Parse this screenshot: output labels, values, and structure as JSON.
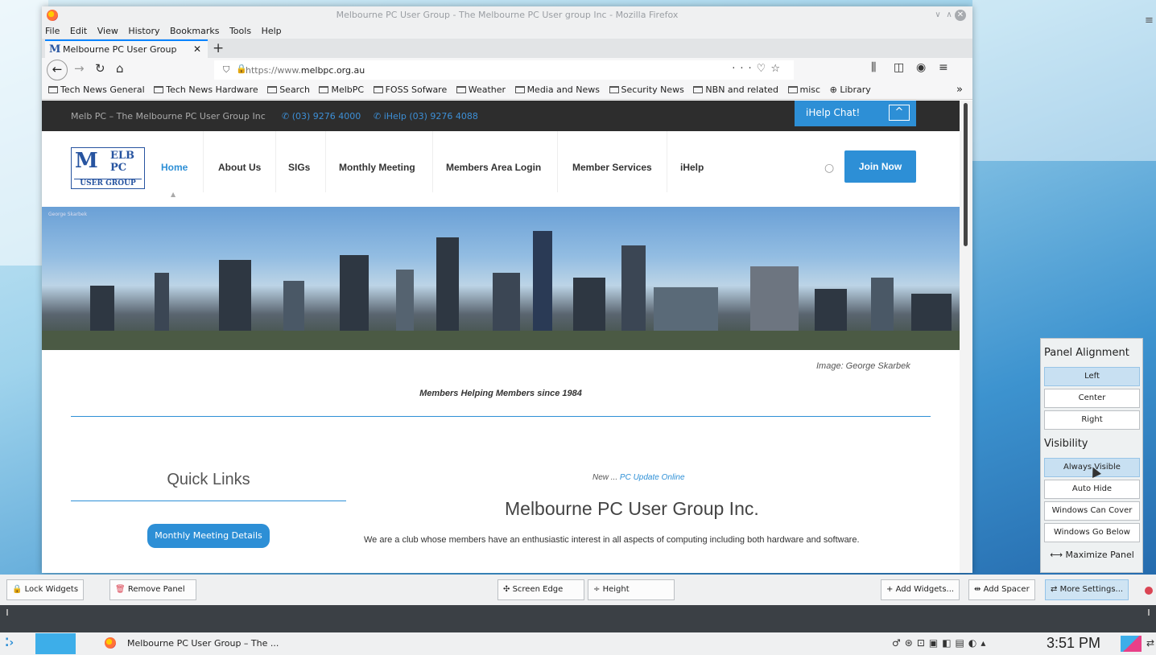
{
  "window": {
    "title": "Melbourne PC User Group - The Melbourne PC User group Inc - Mozilla Firefox",
    "menu": [
      "File",
      "Edit",
      "View",
      "History",
      "Bookmarks",
      "Tools",
      "Help"
    ]
  },
  "tab": {
    "label": "Melbourne PC User Group",
    "favicon": "M"
  },
  "urlbar": {
    "prefix": "https://www.",
    "domain": "melbpc.org.au"
  },
  "bookmarks": [
    "Tech News General",
    "Tech News Hardware",
    "Search",
    "MelbPC",
    "FOSS Sofware",
    "Weather",
    "Media and News",
    "Security News",
    "NBN and related",
    "misc",
    "Library"
  ],
  "site": {
    "top_text": "Melb PC – The Melbourne PC User Group Inc",
    "phone": "(03) 9276 4000",
    "ihelp_phone": "iHelp (03) 9276 4088",
    "ihelp_chat": "iHelp Chat!",
    "logo": {
      "big": "M",
      "line1": "ELB",
      "line2": "PC",
      "line3": "USER GROUP"
    },
    "nav": [
      "Home",
      "About Us",
      "SIGs",
      "Monthly Meeting",
      "Members Area Login",
      "Member Services",
      "iHelp"
    ],
    "join": "Join Now",
    "banner_credit": "George Skarbek",
    "image_caption": "Image: George Skarbek",
    "tagline": "Members Helping Members since 1984",
    "quick_links": "Quick Links",
    "monthly_meeting_btn": "Monthly Meeting Details",
    "new_prefix": "New ... ",
    "new_link": "PC Update Online",
    "heading": "Melbourne PC User Group Inc.",
    "intro": "We are a club whose members have an enthusiastic interest in all aspects of computing including both hardware and software."
  },
  "panel_alignment": {
    "heading": "Panel Alignment",
    "options": [
      "Left",
      "Center",
      "Right"
    ],
    "selected": "Left",
    "visibility_heading": "Visibility",
    "visibility_options": [
      "Always Visible",
      "Auto Hide",
      "Windows Can Cover",
      "Windows Go Below"
    ],
    "visibility_selected": "Always Visible",
    "maximize": "Maximize Panel"
  },
  "panel_toolbar": {
    "lock": "Lock Widgets",
    "remove": "Remove Panel",
    "screen_edge": "Screen Edge",
    "height": "Height",
    "add_widgets": "Add Widgets...",
    "add_spacer": "Add Spacer",
    "more_settings": "More Settings..."
  },
  "taskbar": {
    "task": "Melbourne PC User Group – The ...",
    "clock": "3:51 PM"
  },
  "colors": {
    "accent": "#2d8fd6",
    "panel_select": "#c8e0f2"
  }
}
